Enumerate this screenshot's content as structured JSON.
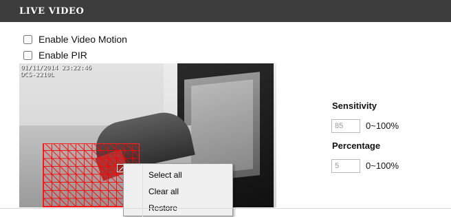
{
  "header": {
    "title": "LIVE VIDEO"
  },
  "checkboxes": [
    {
      "label": "Enable Video Motion",
      "checked": false
    },
    {
      "label": "Enable PIR",
      "checked": false
    }
  ],
  "video": {
    "osd_line1": "01/11/2014 23:22:46",
    "osd_line2": "DCS-2210L"
  },
  "context_menu": {
    "items": [
      "Select all",
      "Clear all",
      "Restore"
    ]
  },
  "sensitivity": {
    "label": "Sensitivity",
    "value": "85",
    "range": "0~100%"
  },
  "percentage": {
    "label": "Percentage",
    "value": "5",
    "range": "0~100%"
  }
}
